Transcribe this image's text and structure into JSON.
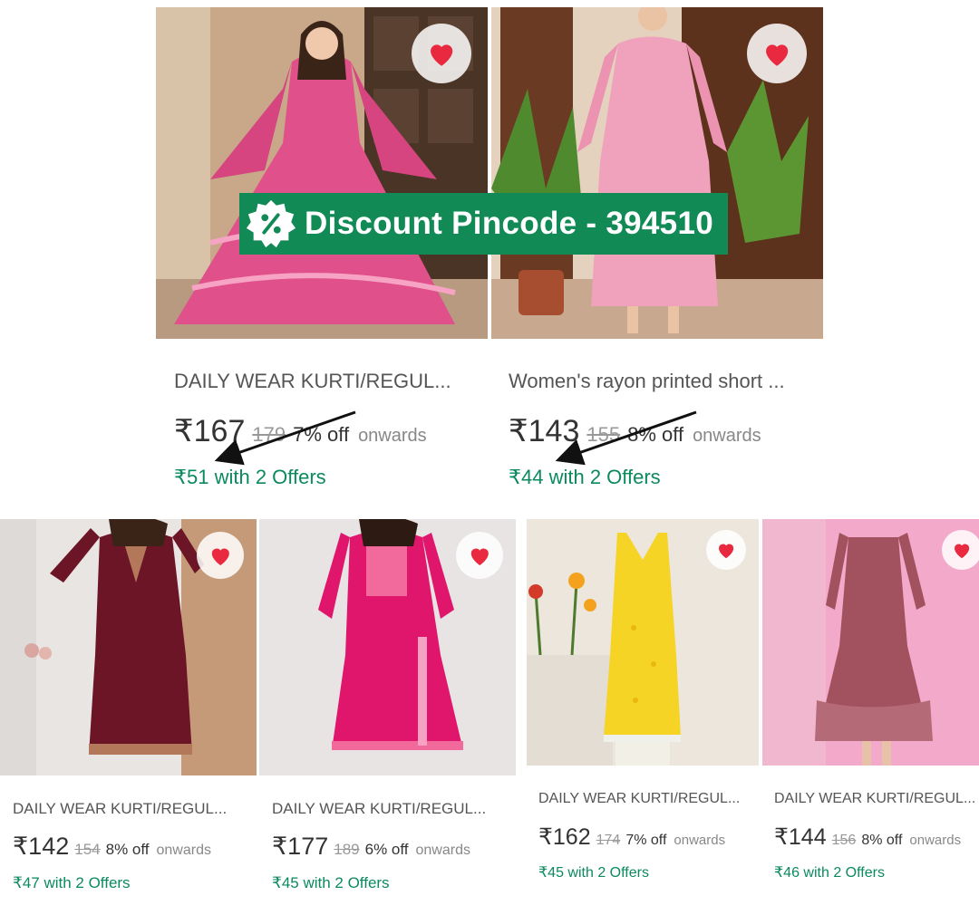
{
  "banner": {
    "text": "Discount Pincode - 394510",
    "icon": "discount-percent-icon",
    "color": "#118a55"
  },
  "colors": {
    "offer_green": "#0b8a5d",
    "heart_red": "#e8293f"
  },
  "products": [
    {
      "title": "DAILY WEAR KURTI/REGUL...",
      "price": "₹167",
      "mrp": "179",
      "off": "7% off",
      "onwards": "onwards",
      "offer": "₹51 with 2 Offers",
      "wishlisted": true
    },
    {
      "title": "Women's rayon printed short ...",
      "price": "₹143",
      "mrp": "155",
      "off": "8% off",
      "onwards": "onwards",
      "offer": "₹44 with 2 Offers",
      "wishlisted": true
    },
    {
      "title": "DAILY WEAR KURTI/REGUL...",
      "price": "₹142",
      "mrp": "154",
      "off": "8% off",
      "onwards": "onwards",
      "offer": "₹47 with 2 Offers",
      "wishlisted": true
    },
    {
      "title": "DAILY WEAR KURTI/REGUL...",
      "price": "₹177",
      "mrp": "189",
      "off": "6% off",
      "onwards": "onwards",
      "offer": "₹45 with 2 Offers",
      "wishlisted": true
    },
    {
      "title": "DAILY WEAR KURTI/REGUL...",
      "price": "₹162",
      "mrp": "174",
      "off": "7% off",
      "onwards": "onwards",
      "offer": "₹45 with 2 Offers",
      "wishlisted": true
    },
    {
      "title": "DAILY WEAR KURTI/REGUL...",
      "price": "₹144",
      "mrp": "156",
      "off": "8% off",
      "onwards": "onwards",
      "offer": "₹46 with 2 Offers",
      "wishlisted": true
    }
  ]
}
